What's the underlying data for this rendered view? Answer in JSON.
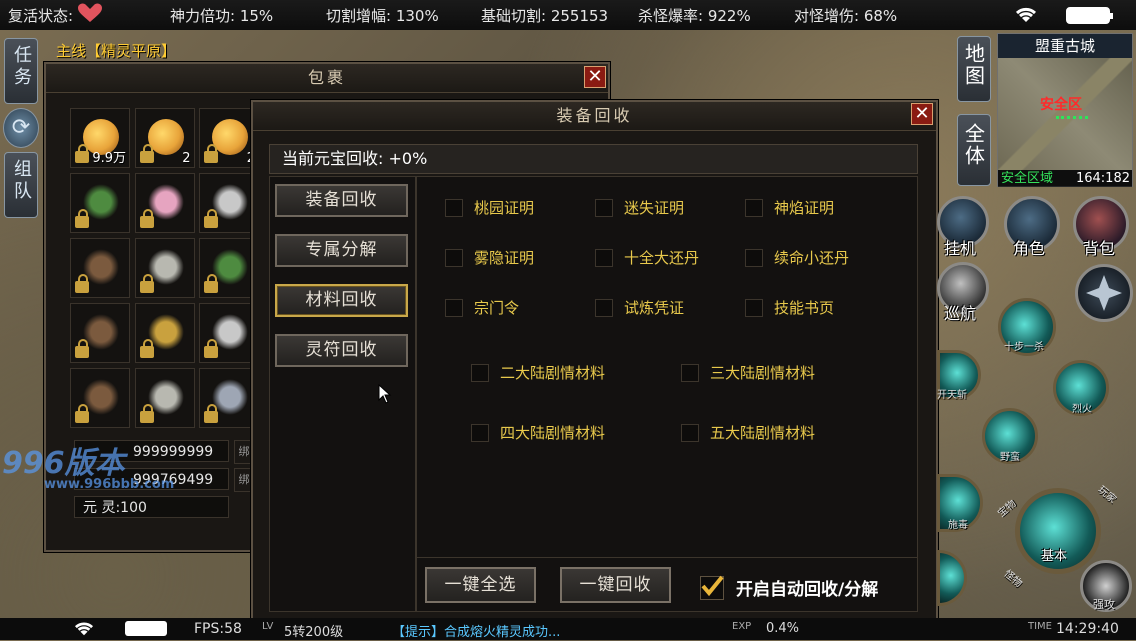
{
  "status_bar": {
    "revive_label": "复活状态:",
    "divine_power": "神力倍功: 15%",
    "cut_increase": "切割增幅: 130%",
    "base_cut": "基础切割: 255153",
    "kill_drop_rate": "杀怪爆率: 922%",
    "monster_damage": "对怪增伤: 68%"
  },
  "left_tabs": {
    "quest": "任务",
    "team": "组队",
    "main_quest": "主线【精灵平原】"
  },
  "bag": {
    "title": "包裹",
    "slots": [
      {
        "count": "9.9万",
        "icon": "gold-ingot-icon"
      },
      {
        "count": "2",
        "icon": "gold-ingot-icon"
      },
      {
        "count": "2",
        "icon": "gold-ingot-icon"
      },
      {
        "count": "",
        "icon": "bracelet-icon"
      },
      {
        "count": "",
        "icon": "fairy-icon"
      },
      {
        "count": "",
        "icon": "necklace-icon"
      },
      {
        "count": "",
        "icon": "boots-icon"
      },
      {
        "count": "",
        "icon": "sword-icon"
      },
      {
        "count": "",
        "icon": "bracelet-icon"
      },
      {
        "count": "",
        "icon": "boots-icon"
      },
      {
        "count": "",
        "icon": "helmet-icon"
      },
      {
        "count": "",
        "icon": "necklace-icon"
      },
      {
        "count": "",
        "icon": "boots-icon"
      },
      {
        "count": "",
        "icon": "sword-icon"
      },
      {
        "count": "",
        "icon": "ring-icon"
      }
    ],
    "gold_value": "999999999",
    "bound_value": "999769499",
    "yuanling_label": "元 灵:100",
    "bind_tag": "绑"
  },
  "recycle": {
    "title": "装备回收",
    "current_rate": "当前元宝回收: +0%",
    "menu": [
      "装备回收",
      "专属分解",
      "材料回收",
      "灵符回收"
    ],
    "active_menu": "材料回收",
    "items_row1": [
      "桃园证明",
      "迷失证明",
      "神焰证明"
    ],
    "items_row2": [
      "雾隐证明",
      "十全大还丹",
      "续命小还丹"
    ],
    "items_row3": [
      "宗门令",
      "试炼凭证",
      "技能书页"
    ],
    "items_row4": [
      "二大陆剧情材料",
      "三大陆剧情材料"
    ],
    "items_row5": [
      "四大陆剧情材料",
      "五大陆剧情材料"
    ],
    "select_all": "一键全选",
    "recycle_all": "一键回收",
    "auto_recycle": "开启自动回收/分解"
  },
  "minimap": {
    "name": "盟重古城",
    "safe_zone": "安全区",
    "safe_area": "安全区域",
    "coords": "164:182",
    "map_btn": "地图",
    "all_btn": "全体"
  },
  "actions": {
    "hang": "挂机",
    "role": "角色",
    "backpack": "背包",
    "patrol": "巡航",
    "skill1": "十步一杀",
    "skill2": "开天斩",
    "skill3": "烈火",
    "skill4": "野蛮",
    "skill5": "施毒",
    "basic": "基本",
    "strong_attack": "强攻",
    "toolbar_1": "宝物",
    "toolbar_2": "玩家",
    "toolbar_3": "怪物"
  },
  "bottom_bar": {
    "fps": "FPS:58",
    "level_tag": "LV",
    "level": "5转200级",
    "tip": "【提示】合成熔火精灵成功...",
    "exp_tag": "EXP",
    "exp": "0.4%",
    "time_tag": "TIME",
    "time": "14:29:40"
  },
  "watermark": {
    "site": "996版本",
    "url": "www.996bbb.com"
  },
  "colors": {
    "item_text": "#e8c94c",
    "active_border": "#c9a84a",
    "close_red": "#8a1b12"
  }
}
